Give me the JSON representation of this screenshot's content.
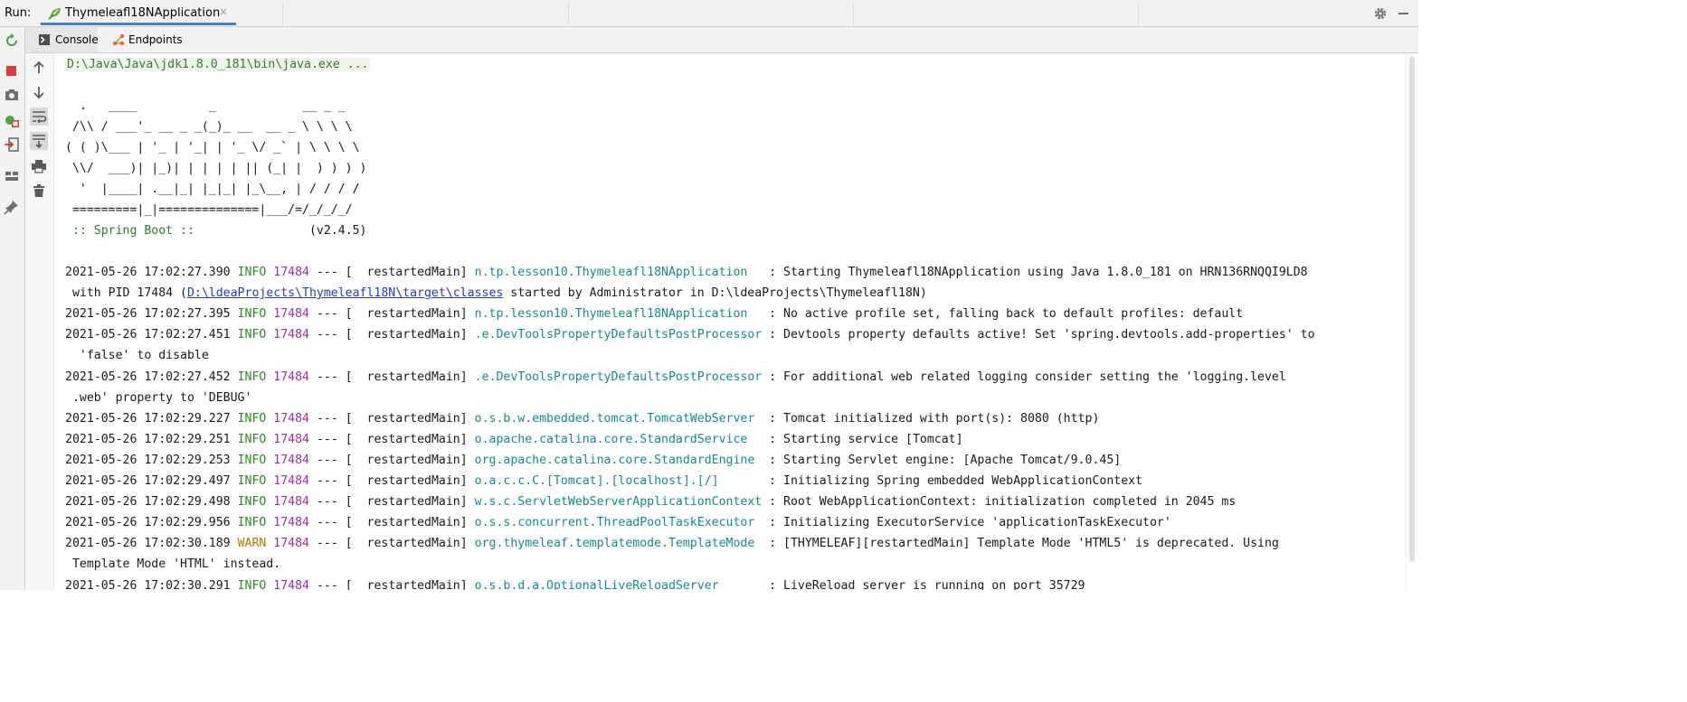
{
  "run_bar": {
    "label": "Run:",
    "tab_label": "Thymeleafl18NApplication",
    "tab_close": "×"
  },
  "tool_tabs": [
    {
      "label": "Console",
      "icon": "console-icon"
    },
    {
      "label": "Endpoints",
      "icon": "endpoints-icon"
    }
  ],
  "left_toolbar_icons": [
    "rerun-icon",
    "stop-icon",
    "screenshot-icon",
    "debug-icon",
    "exit-icon",
    "layout-icon",
    "pin-icon"
  ],
  "inner_toolbar_icons": [
    "up-arrow-icon",
    "down-arrow-icon",
    "soft-wrap-icon",
    "scroll-to-end-icon",
    "print-icon",
    "trash-icon"
  ],
  "console": {
    "java_cmd": "D:\\Java\\Java\\jdk1.8.0_181\\bin\\java.exe ...",
    "banner": [
      "  .   ____          _            __ _ _",
      " /\\\\ / ___'_ __ _ _(_)_ __  __ _ \\ \\ \\ \\",
      "( ( )\\___ | '_ | '_| | '_ \\/ _` | \\ \\ \\ \\",
      " \\\\/  ___)| |_)| | | | | || (_| |  ) ) ) )",
      "  '  |____| .__|_| |_|_| |_\\__, | / / / /",
      " =========|_|==============|___/=/_/_/_/"
    ],
    "spring_boot_label": " :: Spring Boot :: ",
    "spring_boot_version": "               (v2.4.5)",
    "logs": [
      {
        "ts": "2021-05-26 17:02:27.390",
        "level": "INFO",
        "pid": "17484",
        "thread": " --- [  restartedMain] ",
        "logger": "n.tp.lesson10.Thymeleafl18NApplication  ",
        "msg": " : Starting Thymeleafl18NApplication using Java 1.8.0_181 on HRN136RNQQI9LD8",
        "cont": [
          {
            "pre": " with PID 17484 (",
            "link": "D:\\ldeaProjects\\Thymeleafl18N\\target\\classes",
            "post": " started by Administrator in D:\\ldeaProjects\\Thymeleafl18N)"
          }
        ]
      },
      {
        "ts": "2021-05-26 17:02:27.395",
        "level": "INFO",
        "pid": "17484",
        "thread": " --- [  restartedMain] ",
        "logger": "n.tp.lesson10.Thymeleafl18NApplication  ",
        "msg": " : No active profile set, falling back to default profiles: default",
        "cont": []
      },
      {
        "ts": "2021-05-26 17:02:27.451",
        "level": "INFO",
        "pid": "17484",
        "thread": " --- [  restartedMain] ",
        "logger": ".e.DevToolsPropertyDefaultsPostProcessor",
        "msg": " : Devtools property defaults active! Set 'spring.devtools.add-properties' to",
        "cont": [
          {
            "pre": "  'false' to disable",
            "link": "",
            "post": ""
          }
        ]
      },
      {
        "ts": "2021-05-26 17:02:27.452",
        "level": "INFO",
        "pid": "17484",
        "thread": " --- [  restartedMain] ",
        "logger": ".e.DevToolsPropertyDefaultsPostProcessor",
        "msg": " : For additional web related logging consider setting the 'logging.level",
        "cont": [
          {
            "pre": " .web' property to 'DEBUG'",
            "link": "",
            "post": ""
          }
        ]
      },
      {
        "ts": "2021-05-26 17:02:29.227",
        "level": "INFO",
        "pid": "17484",
        "thread": " --- [  restartedMain] ",
        "logger": "o.s.b.w.embedded.tomcat.TomcatWebServer ",
        "msg": " : Tomcat initialized with port(s): 8080 (http)",
        "cont": []
      },
      {
        "ts": "2021-05-26 17:02:29.251",
        "level": "INFO",
        "pid": "17484",
        "thread": " --- [  restartedMain] ",
        "logger": "o.apache.catalina.core.StandardService  ",
        "msg": " : Starting service [Tomcat]",
        "cont": []
      },
      {
        "ts": "2021-05-26 17:02:29.253",
        "level": "INFO",
        "pid": "17484",
        "thread": " --- [  restartedMain] ",
        "logger": "org.apache.catalina.core.StandardEngine ",
        "msg": " : Starting Servlet engine: [Apache Tomcat/9.0.45]",
        "cont": []
      },
      {
        "ts": "2021-05-26 17:02:29.497",
        "level": "INFO",
        "pid": "17484",
        "thread": " --- [  restartedMain] ",
        "logger": "o.a.c.c.C.[Tomcat].[localhost].[/]      ",
        "msg": " : Initializing Spring embedded WebApplicationContext",
        "cont": []
      },
      {
        "ts": "2021-05-26 17:02:29.498",
        "level": "INFO",
        "pid": "17484",
        "thread": " --- [  restartedMain] ",
        "logger": "w.s.c.ServletWebServerApplicationContext",
        "msg": " : Root WebApplicationContext: initialization completed in 2045 ms",
        "cont": []
      },
      {
        "ts": "2021-05-26 17:02:29.956",
        "level": "INFO",
        "pid": "17484",
        "thread": " --- [  restartedMain] ",
        "logger": "o.s.s.concurrent.ThreadPoolTaskExecutor ",
        "msg": " : Initializing ExecutorService 'applicationTaskExecutor'",
        "cont": []
      },
      {
        "ts": "2021-05-26 17:02:30.189",
        "level": "WARN",
        "pid": "17484",
        "thread": " --- [  restartedMain] ",
        "logger": "org.thymeleaf.templatemode.TemplateMode ",
        "msg": " : [THYMELEAF][restartedMain] Template Mode 'HTML5' is deprecated. Using",
        "cont": [
          {
            "pre": " Template Mode 'HTML' instead.",
            "link": "",
            "post": ""
          }
        ]
      },
      {
        "ts": "2021-05-26 17:02:30.291",
        "level": "INFO",
        "pid": "17484",
        "thread": " --- [  restartedMain] ",
        "logger": "o.s.b.d.a.OptionalLiveReloadServer      ",
        "msg": " : LiveReload server is running on port 35729",
        "cont": []
      }
    ]
  },
  "colors": {
    "accent": "#4083c9",
    "info": "#2f8a25",
    "warn": "#b07b00",
    "pid": "#a02fa0",
    "logger": "#178a8a"
  }
}
